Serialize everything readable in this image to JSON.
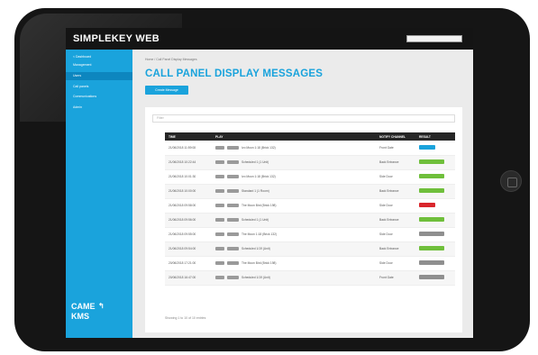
{
  "brand": {
    "title": "SIMPLEKEY WEB"
  },
  "topbar": {
    "search_placeholder": ""
  },
  "sidebar": {
    "items": [
      {
        "label": "< Dashboard"
      },
      {
        "label": "Management"
      },
      {
        "label": "Users"
      },
      {
        "label": "Call panels"
      },
      {
        "label": "Communications"
      },
      {
        "label": "Admin"
      }
    ],
    "active_index": 2,
    "logo_line1": "CAME",
    "logo_line2": "KMS",
    "logo_arrow": "↰"
  },
  "main": {
    "breadcrumb": "Home  /  Call Panel Display Messages",
    "page_title": "CALL PANEL DISPLAY MESSAGES",
    "new_button": "Create Message",
    "filter_placeholder": "Filter",
    "table": {
      "headers": [
        "TIME",
        "PLAY",
        "NOTIFY CHANNEL",
        "RESULT"
      ],
      "rows": [
        {
          "time": "21/06/2018 11:59:08",
          "message": "Ivo Moon 1:18 (Brick 132)",
          "channel": "Front Gate",
          "status": "blue"
        },
        {
          "time": "21/06/2018 10:22:44",
          "message": "Scheduled 1 (1 Unit)",
          "channel": "Back Entrance",
          "status": "green"
        },
        {
          "time": "21/06/2018 10:01:30",
          "message": "Ivo Moon 1:18 (Brick 132)",
          "channel": "Side Door",
          "status": "green"
        },
        {
          "time": "21/06/2018 10:00:00",
          "message": "Standard 1 (1 Room)",
          "channel": "Back Entrance",
          "status": "green"
        },
        {
          "time": "21/06/2018 09:58:00",
          "message": "The Moon Bird (Brick 198)",
          "channel": "Side Door",
          "status": "red"
        },
        {
          "time": "21/06/2018 09:56:00",
          "message": "Scheduled 1 (1 Unit)",
          "channel": "Back Entrance",
          "status": "green"
        },
        {
          "time": "21/06/2018 09:55:00",
          "message": "The Moon 1:18 (Brick 132)",
          "channel": "Side Door",
          "status": "gray"
        },
        {
          "time": "21/06/2018 09:54:00",
          "message": "Scheduled 1/19 (Unit)",
          "channel": "Back Entrance",
          "status": "green"
        },
        {
          "time": "20/06/2018 17:21:00",
          "message": "The Moon Bird (Brick 198)",
          "channel": "Side Door",
          "status": "gray"
        },
        {
          "time": "20/06/2018 16:47:00",
          "message": "Scheduled 1/19 (Unit)",
          "channel": "Front Gate",
          "status": "gray"
        }
      ]
    },
    "footnote": "Showing 1 to 10 of 10 entries"
  },
  "colors": {
    "accent": "#1aa3dc",
    "sidebar": "#1aa3dc",
    "topbar": "#141414",
    "status_blue": "#1aa3dc",
    "status_green": "#6fbf3b",
    "status_red": "#d9262c",
    "status_gray": "#8f8f8f"
  }
}
